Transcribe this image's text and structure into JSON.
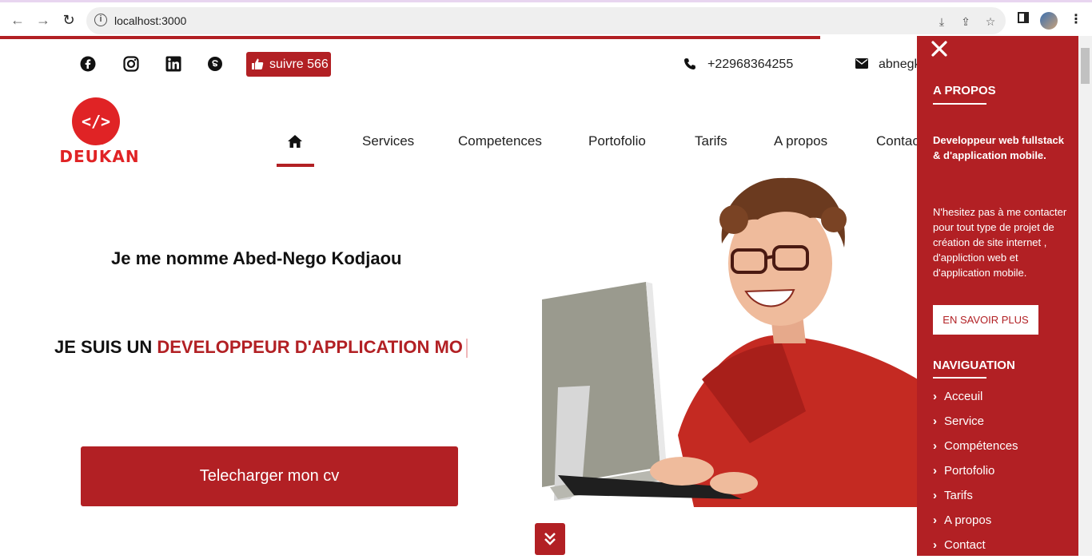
{
  "browser": {
    "url": "localhost:3000"
  },
  "topbar": {
    "follow_label": "suivre 566",
    "phone": "+22968364255",
    "email": "abnegk"
  },
  "logo": {
    "symbol": "</>",
    "word": "DEUKAN"
  },
  "nav": {
    "items": [
      {
        "label": "Services"
      },
      {
        "label": "Competences"
      },
      {
        "label": "Portofolio"
      },
      {
        "label": "Tarifs"
      },
      {
        "label": "A propos"
      },
      {
        "label": "Contac"
      }
    ]
  },
  "hero": {
    "name": "Je me nomme Abed-Nego Kodjaou",
    "role_prefix": "JE SUIS UN ",
    "role_accent": "DEVELOPPEUR D'APPLICATION MO",
    "cv_button": "Telecharger mon cv"
  },
  "side": {
    "about_heading": "A PROPOS",
    "about_bold": "Developpeur web fullstack & d'application mobile.",
    "about_text": "N'hesitez pas à me contacter pour tout type de projet de création de site internet , d'appliction web et d'application mobile.",
    "more_button": "EN SAVOIR PLUS",
    "nav_heading": "NAVIGUATION",
    "links": [
      {
        "label": "Acceuil"
      },
      {
        "label": "Service"
      },
      {
        "label": "Compétences"
      },
      {
        "label": "Portofolio"
      },
      {
        "label": "Tarifs"
      },
      {
        "label": "A propos"
      },
      {
        "label": "Contact"
      }
    ]
  },
  "colors": {
    "accent": "#b22024",
    "logo_red": "#e02325"
  }
}
